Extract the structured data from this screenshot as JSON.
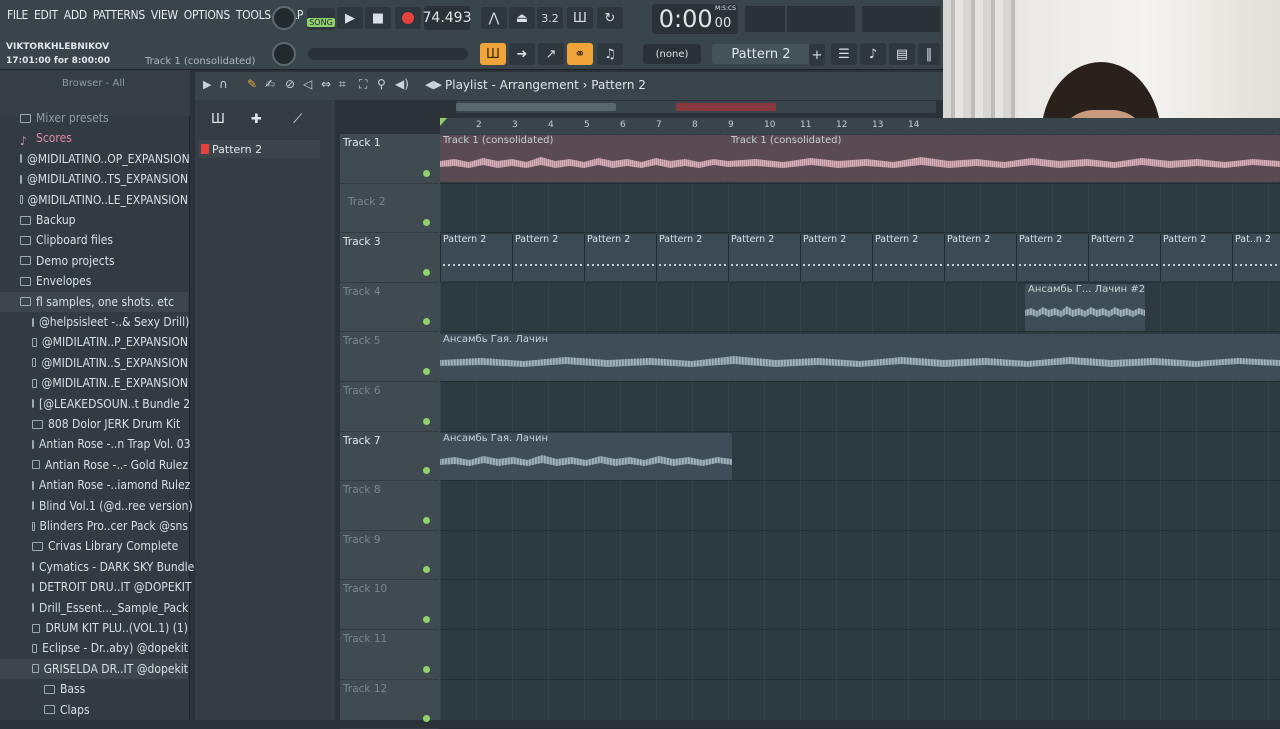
{
  "menu": [
    "FILE",
    "EDIT",
    "ADD",
    "PATTERNS",
    "VIEW",
    "OPTIONS",
    "TOOLS",
    "HELP"
  ],
  "user": {
    "name": "VIKTORKHLEBNIKOV",
    "time": "17:01:00 for 8:00:00",
    "hint": "Track 1 (consolidated)"
  },
  "transport": {
    "mode": "SONG",
    "tempo": "74.493",
    "time": "0:00",
    "time_small": "00",
    "time_label": "M:S:CS"
  },
  "snap": "(none)",
  "pattern_selector": "Pattern 2",
  "browser": {
    "label": "Browser - All",
    "items": [
      "Mixer presets",
      "Scores",
      "@MIDILATINO..OP_EXPANSION",
      "@MIDILATINO..TS_EXPANSION",
      "@MIDILATINO..LE_EXPANSION",
      "Backup",
      "Clipboard files",
      "Demo projects",
      "Envelopes",
      "fl samples, one shots. etc",
      "@helpsisleet -..& Sexy Drill)",
      "@MIDILATIN..P_EXPANSION",
      "@MIDILATIN..S_EXPANSION",
      "@MIDILATIN..E_EXPANSION",
      "[@LEAKEDSOUN..t Bundle 2",
      "808 Dolor JERK Drum Kit",
      "Antian Rose -..n Trap Vol. 03",
      "Antian Rose -..- Gold Rulez",
      "Antian Rose -..iamond Rulez",
      "Blind Vol.1 (@d..ree version)",
      "Blinders Pro..cer Pack @sns",
      "Crivas Library Complete",
      "Cymatics - DARK SKY Bundle",
      "DETROIT DRU..IT @DOPEKIT",
      "Drill_Essent..._Sample_Pack",
      "DRUM KIT PLU..(VOL.1) (1)",
      "Eclipse - Dr..aby) @dopekit",
      "GRISELDA DR..IT @dopekit",
      "Bass",
      "Claps"
    ]
  },
  "playlist": {
    "title": "Playlist - Arrangement",
    "pattern": "Pattern 2",
    "pattern_list": [
      "Pattern 2"
    ],
    "ruler": [
      "2",
      "3",
      "4",
      "5",
      "6",
      "7",
      "8",
      "9",
      "10",
      "11",
      "12",
      "13",
      "14"
    ],
    "tracks": [
      "Track 1",
      "Track 2",
      "Track 3",
      "Track 4",
      "Track 5",
      "Track 6",
      "Track 7",
      "Track 8",
      "Track 9",
      "Track 10",
      "Track 11",
      "Track 12"
    ],
    "clip_audio_1": "Track 1 (consolidated)",
    "clip_pattern": "Pattern 2",
    "clip_pattern_last": "Pat..n 2",
    "clip_ensemble": "Ансамбь Гая. Лачин",
    "clip_ensemble_short": "Ансамбь Г... Лачин #2"
  }
}
